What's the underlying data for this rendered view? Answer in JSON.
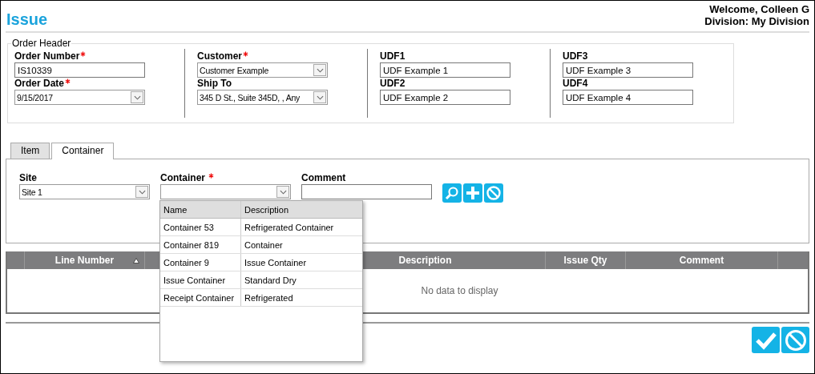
{
  "page": {
    "title": "Issue",
    "welcome": "Welcome, Colleen G",
    "division": "Division: My Division"
  },
  "order_header": {
    "legend": "Order Header",
    "columns": [
      [
        {
          "label": "Order Number",
          "required": true,
          "kind": "text",
          "value": "IS10339"
        },
        {
          "label": "Order Date",
          "required": true,
          "kind": "select",
          "value": "9/15/2017"
        }
      ],
      [
        {
          "label": "Customer",
          "required": true,
          "kind": "select",
          "value": "Customer Example"
        },
        {
          "label": "Ship To",
          "required": false,
          "kind": "select",
          "value": "345 D St., Suite 345D, , Any"
        }
      ],
      [
        {
          "label": "UDF1",
          "required": false,
          "kind": "text",
          "value": "UDF Example 1"
        },
        {
          "label": "UDF2",
          "required": false,
          "kind": "text",
          "value": "UDF Example 2"
        }
      ],
      [
        {
          "label": "UDF3",
          "required": false,
          "kind": "text",
          "value": "UDF Example 3"
        },
        {
          "label": "UDF4",
          "required": false,
          "kind": "text",
          "value": "UDF Example 4"
        }
      ]
    ]
  },
  "tabs": [
    {
      "label": "Item",
      "selected": false
    },
    {
      "label": "Container",
      "selected": true
    }
  ],
  "container_form": {
    "fields": [
      {
        "label": "Site",
        "required": false,
        "kind": "select",
        "value": "Site 1"
      },
      {
        "label": "Container",
        "required": true,
        "kind": "select"
      },
      {
        "label": "Comment",
        "required": false,
        "kind": "text"
      }
    ],
    "actions": [
      {
        "kind": "search"
      },
      {
        "kind": "add"
      },
      {
        "kind": "cancel"
      }
    ]
  },
  "dropdown": {
    "columns": [
      "Name",
      "Description"
    ],
    "rows": [
      {
        "name": "Container 53",
        "description": "Refrigerated Container"
      },
      {
        "name": "Container 819",
        "description": "Container"
      },
      {
        "name": "Container 9",
        "description": "Issue Container"
      },
      {
        "name": "Issue Container",
        "description": "Standard Dry"
      },
      {
        "name": "Receipt Container",
        "description": "Refrigerated"
      }
    ]
  },
  "grid": {
    "columns": [
      {
        "label": "Line Number",
        "sorted": true
      },
      {
        "label": "Description"
      },
      {
        "label": "Issue Qty"
      },
      {
        "label": "Comment"
      }
    ],
    "empty_text": "No data to display"
  },
  "footer_actions": [
    {
      "kind": "confirm"
    },
    {
      "kind": "cancel"
    }
  ]
}
